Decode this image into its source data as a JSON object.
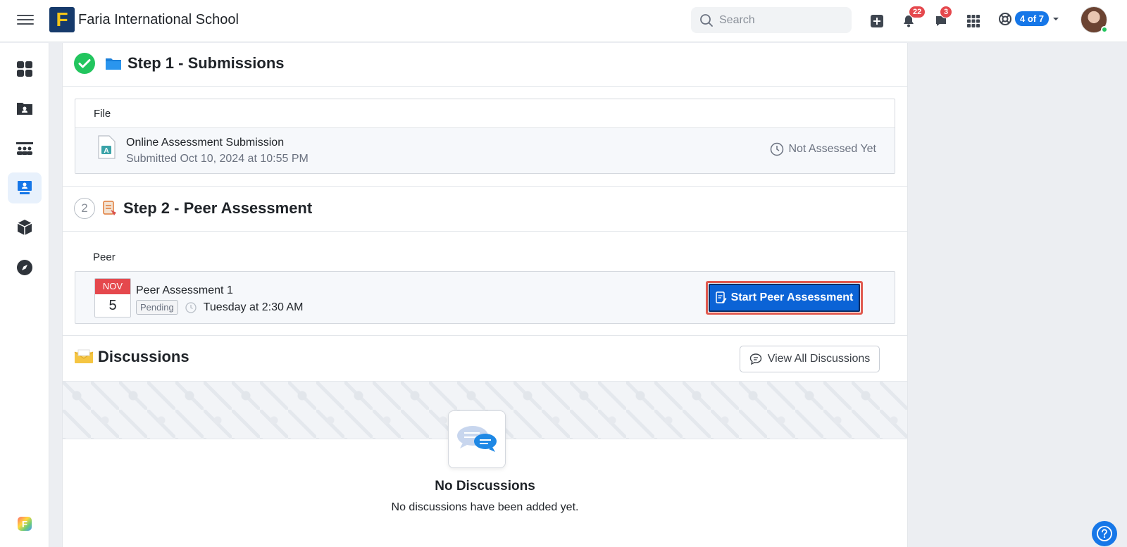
{
  "header": {
    "school_name": "Faria International School",
    "logo_letter": "F",
    "search_placeholder": "Search",
    "notifications_count": "22",
    "messages_count": "3",
    "portal_switcher": "4 of 7"
  },
  "sidebar": {
    "items": [
      {
        "icon": "dashboard-grid-icon"
      },
      {
        "icon": "portfolio-folder-icon"
      },
      {
        "icon": "classes-icon"
      },
      {
        "icon": "assessment-board-icon",
        "active": true
      },
      {
        "icon": "box-icon"
      },
      {
        "icon": "compass-icon"
      }
    ],
    "bottom_logo_letter": "F"
  },
  "step1": {
    "title": "Step 1 - Submissions",
    "file_label": "File",
    "file_name": "Online Assessment Submission",
    "file_submitted": "Submitted Oct 10, 2024 at 10:55 PM",
    "status": "Not Assessed Yet",
    "file_icon_letter": "A"
  },
  "step2": {
    "number": "2",
    "title": "Step 2 - Peer Assessment",
    "peer_label": "Peer",
    "cal_month": "NOV",
    "cal_day": "5",
    "assessment_name": "Peer Assessment 1",
    "pending_badge": "Pending",
    "due": "Tuesday at 2:30 AM",
    "start_button": "Start Peer Assessment"
  },
  "discussions": {
    "title": "Discussions",
    "view_all_button": "View All Discussions",
    "empty_title": "No Discussions",
    "empty_subtitle": "No discussions have been added yet."
  },
  "colors": {
    "primary": "#0b63d6",
    "badge_red": "#e5484d",
    "success_green": "#22c55e"
  }
}
